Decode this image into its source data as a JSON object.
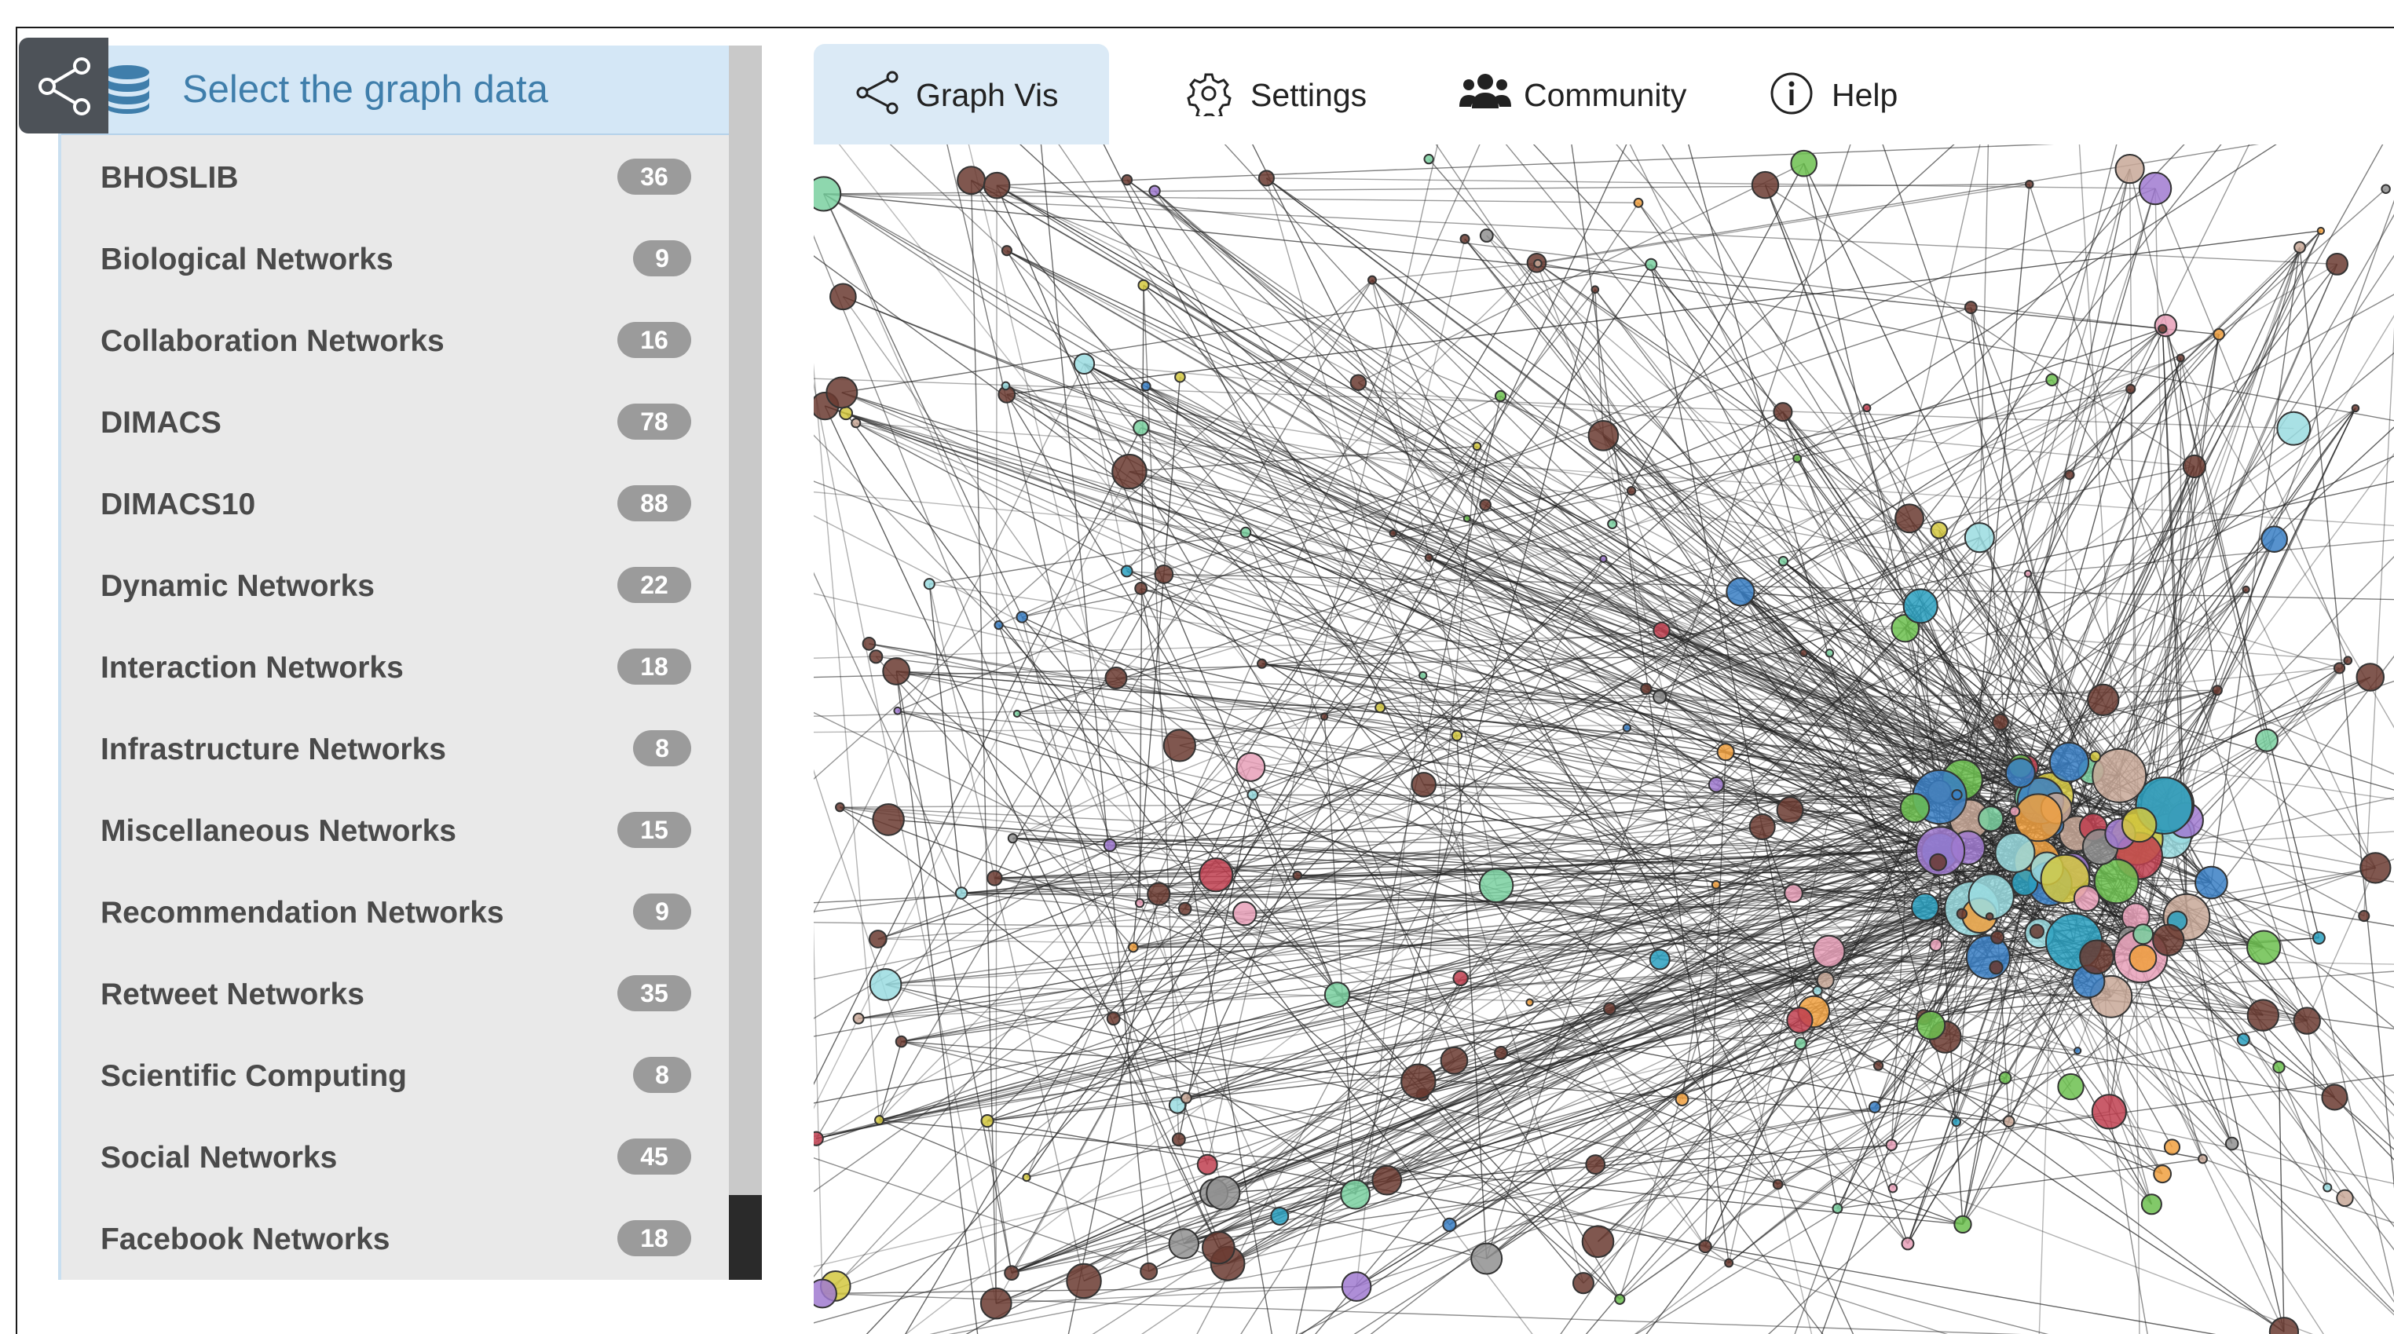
{
  "sidebar": {
    "title": "Select the graph data",
    "items": [
      {
        "label": "BHOSLIB",
        "count": "36"
      },
      {
        "label": "Biological Networks",
        "count": "9"
      },
      {
        "label": "Collaboration Networks",
        "count": "16"
      },
      {
        "label": "DIMACS",
        "count": "78"
      },
      {
        "label": "DIMACS10",
        "count": "88"
      },
      {
        "label": "Dynamic Networks",
        "count": "22"
      },
      {
        "label": "Interaction Networks",
        "count": "18"
      },
      {
        "label": "Infrastructure Networks",
        "count": "8"
      },
      {
        "label": "Miscellaneous Networks",
        "count": "15"
      },
      {
        "label": "Recommendation Networks",
        "count": "9"
      },
      {
        "label": "Retweet Networks",
        "count": "35"
      },
      {
        "label": "Scientific Computing",
        "count": "8"
      },
      {
        "label": "Social Networks",
        "count": "45"
      },
      {
        "label": "Facebook Networks",
        "count": "18"
      }
    ]
  },
  "tabs": [
    {
      "label": "Graph Vis",
      "icon": "share-icon",
      "active": true
    },
    {
      "label": "Settings",
      "icon": "gear-icon",
      "active": false
    },
    {
      "label": "Community",
      "icon": "users-icon",
      "active": false
    },
    {
      "label": "Help",
      "icon": "info-icon",
      "active": false
    }
  ],
  "colors": {
    "sidebar_title": "#3f7eab",
    "active_tab": "#dbeaf6",
    "badge": "#9b9b9b",
    "node_palette": [
      "#e8a0b8",
      "#6cbf4f",
      "#3a7fc4",
      "#c04050",
      "#a07ad0",
      "#f0a040",
      "#9adce0",
      "#d4c840",
      "#c8a898",
      "#7ad0a0",
      "#909090",
      "#2aa0c0"
    ]
  },
  "graph": {
    "type": "network",
    "description_visible": "node-link graph visualization with a dense colored cluster"
  }
}
